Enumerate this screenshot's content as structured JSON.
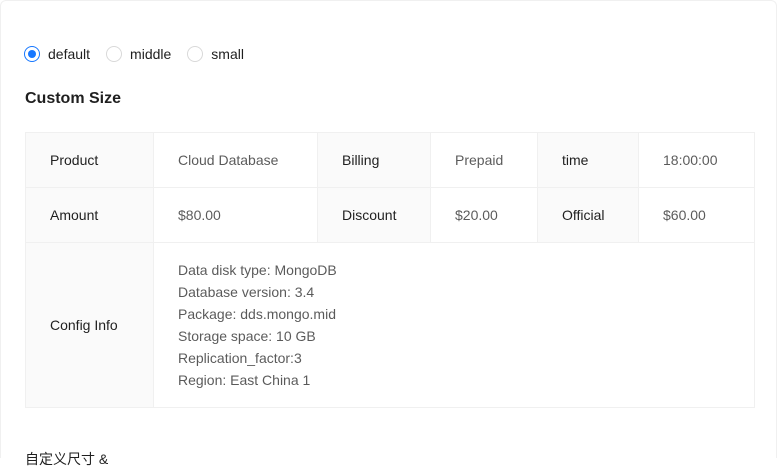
{
  "size_options": [
    {
      "label": "default",
      "checked": true
    },
    {
      "label": "middle",
      "checked": false
    },
    {
      "label": "small",
      "checked": false
    }
  ],
  "section_title": "Custom Size",
  "descriptions": {
    "product_label": "Product",
    "product_value": "Cloud Database",
    "billing_label": "Billing",
    "billing_value": "Prepaid",
    "time_label": "time",
    "time_value": "18:00:00",
    "amount_label": "Amount",
    "amount_value": "$80.00",
    "discount_label": "Discount",
    "discount_value": "$20.00",
    "official_label": "Official",
    "official_value": "$60.00",
    "config_label": "Config Info",
    "config_lines": [
      "Data disk type: MongoDB",
      "Database version: 3.4",
      "Package: dds.mongo.mid",
      "Storage space: 10 GB",
      "Replication_factor:3",
      "Region: East China 1"
    ]
  },
  "next_section_title": "自定义尺寸 &",
  "colors": {
    "primary": "#1677ff",
    "border": "#f0f0f0",
    "label_bg": "#fafafa"
  }
}
